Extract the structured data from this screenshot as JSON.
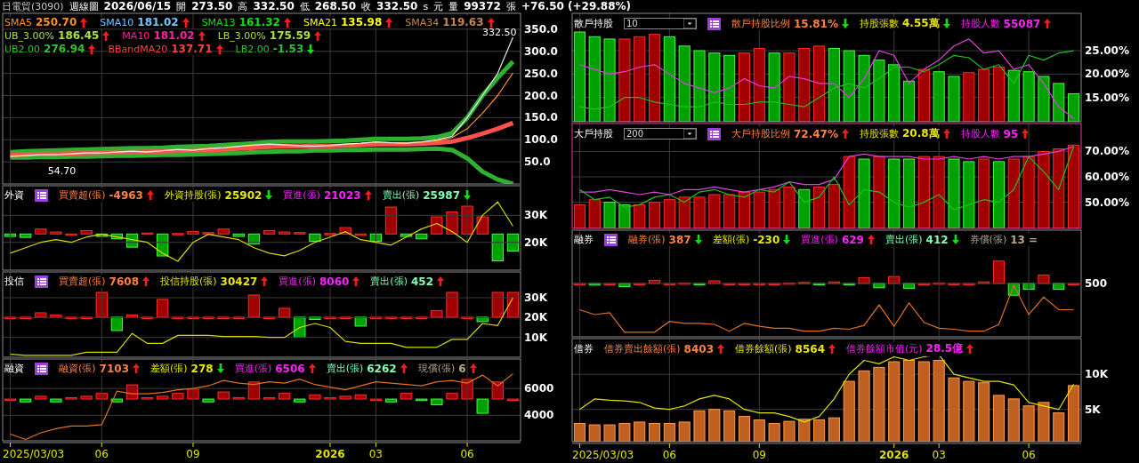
{
  "header": {
    "stock": "日電貿(3090)",
    "period": "週線圖",
    "date": "2026/06/15",
    "quotes": [
      {
        "label": "開",
        "value": "273.50"
      },
      {
        "label": "高",
        "value": "332.50"
      },
      {
        "label": "低",
        "value": "268.50"
      },
      {
        "label": "收",
        "value": "332.50",
        "suffixes": [
          "s",
          "元"
        ]
      },
      {
        "label": "量",
        "value": "99372",
        "suffixes": [
          "張"
        ]
      }
    ],
    "change": "+76.50 (+29.88%)"
  },
  "left": {
    "panels": [
      {
        "kind": "price",
        "legend_rows": [
          [
            {
              "label": "SMA5",
              "value": "250.70",
              "rising": true,
              "color": "#ff9020"
            },
            {
              "label": "SMA10",
              "value": "181.02",
              "rising": true,
              "color": "#70c8ff"
            },
            {
              "label": "SMA13",
              "value": "161.32",
              "rising": true,
              "color": "#10e010"
            },
            {
              "label": "SMA21",
              "value": "135.98",
              "rising": true,
              "color": "#ffff00"
            },
            {
              "label": "SMA34",
              "value": "119.63",
              "rising": true,
              "color": "#c08850"
            }
          ],
          [
            {
              "label": "UB_3.00%",
              "value": "186.45",
              "rising": true,
              "color": "#a8e040"
            },
            {
              "label": "MA10",
              "value": "181.02",
              "rising": true,
              "color": "#ff20a0"
            },
            {
              "label": "LB_3.00%",
              "value": "175.59",
              "rising": true,
              "color": "#a8e040"
            }
          ],
          [
            {
              "label": "UB2.00",
              "value": "276.94",
              "rising": true,
              "color": "#30c030"
            },
            {
              "label": "BBandMA20",
              "value": "137.71",
              "rising": true,
              "color": "#ff4040"
            },
            {
              "label": "LB2.00",
              "value": "-1.53",
              "rising": false,
              "color": "#30c030"
            }
          ]
        ],
        "chart_data": {
          "type": "line",
          "grid": true,
          "ylim": [
            0,
            386
          ],
          "yticks": [
            {
              "value": 50,
              "label": "50.0"
            },
            {
              "value": 100,
              "label": "100.0"
            },
            {
              "value": 150,
              "label": "150.0"
            },
            {
              "value": 200,
              "label": "200.0"
            },
            {
              "value": 250,
              "label": "250.0"
            },
            {
              "value": 300,
              "label": "300.0"
            },
            {
              "value": 350,
              "label": "350.0"
            }
          ],
          "annotations": [
            "332.50",
            "54.70"
          ],
          "series": [
            {
              "color": "#30b030",
              "values": [
                72,
                74,
                75,
                76,
                77,
                78,
                79,
                80,
                81,
                81,
                82,
                84,
                85,
                86,
                88,
                90,
                92,
                95,
                96,
                96,
                96,
                97,
                98,
                100,
                102,
                102,
                102,
                103,
                106,
                115,
                150,
                200,
                240,
                277
              ]
            },
            {
              "color": "#30b030",
              "values": [
                60,
                60,
                61,
                61,
                62,
                62,
                63,
                64,
                64,
                65,
                66,
                66,
                67,
                68,
                69,
                70,
                72,
                73,
                74,
                74,
                76,
                76,
                77,
                77,
                78,
                78,
                78,
                79,
                80,
                77,
                58,
                28,
                10,
                0
              ]
            },
            {
              "color": "#ff5050",
              "values": [
                66,
                67,
                68,
                68,
                69,
                70,
                71,
                72,
                72,
                73,
                74,
                75,
                76,
                77,
                78,
                80,
                82,
                84,
                85,
                85,
                86,
                86,
                87,
                88,
                90,
                90,
                90,
                91,
                93,
                96,
                104,
                114,
                125,
                138
              ]
            },
            {
              "color": "#ff9020",
              "values": [
                63,
                65,
                66,
                67,
                68,
                70,
                71,
                72,
                73,
                73,
                75,
                77,
                77,
                79,
                81,
                84,
                87,
                89,
                89,
                87,
                86,
                86,
                89,
                91,
                94,
                93,
                93,
                94,
                98,
                105,
                125,
                160,
                200,
                251
              ]
            },
            {
              "color": "#e8e8e8",
              "values": [
                62,
                64,
                66,
                66,
                68,
                70,
                70,
                72,
                74,
                72,
                75,
                78,
                76,
                80,
                82,
                85,
                88,
                90,
                88,
                86,
                85,
                87,
                90,
                92,
                95,
                93,
                92,
                95,
                100,
                108,
                150,
                200,
                250,
                332
              ]
            }
          ]
        }
      },
      {
        "kind": "flow",
        "title": "外資",
        "active": false,
        "has_menu": true,
        "stats": [
          {
            "label": "買賣超(張)",
            "value": "-4963",
            "rising": true,
            "color": "#ff8040"
          },
          {
            "label": "外資持股(張)",
            "value": "25902",
            "rising": false,
            "color": "#e8e800"
          },
          {
            "label": "買進(張)",
            "value": "21023",
            "rising": true,
            "color": "#ff20ff"
          },
          {
            "label": "賣出(張)",
            "value": "25987",
            "rising": false,
            "color": "#80ffb0"
          }
        ],
        "chart_data": {
          "type": "line",
          "grid": true,
          "ylim": [
            9700,
            41000
          ],
          "yticks": [
            {
              "value": 20000,
              "label": "20K"
            },
            {
              "value": 30000,
              "label": "30K"
            }
          ],
          "series": [
            {
              "color": "#d8d800",
              "values": [
                16000,
                18000,
                20000,
                21000,
                20000,
                22000,
                23000,
                22000,
                21000,
                20000,
                16000,
                13000,
                20000,
                23000,
                22000,
                21000,
                18000,
                16000,
                15000,
                17000,
                20000,
                22000,
                24000,
                21000,
                20000,
                19000,
                22000,
                25000,
                27000,
                24000,
                20000,
                30000,
                35000,
                26000
              ]
            }
          ]
        }
      },
      {
        "kind": "flow",
        "title": "投信",
        "active": false,
        "has_menu": true,
        "stats": [
          {
            "label": "買賣超(張)",
            "value": "7608",
            "rising": true,
            "color": "#ff8040"
          },
          {
            "label": "投信持股(張)",
            "value": "30427",
            "rising": true,
            "color": "#e8e800"
          },
          {
            "label": "買進(張)",
            "value": "8060",
            "rising": true,
            "color": "#ff20ff"
          },
          {
            "label": "賣出(張)",
            "value": "452",
            "rising": true,
            "color": "#80ffb0"
          }
        ],
        "chart_data": {
          "type": "line",
          "grid": true,
          "ylim": [
            0,
            43000
          ],
          "yticks": [
            {
              "value": 10000,
              "label": "10K"
            },
            {
              "value": 20000,
              "label": "20K"
            },
            {
              "value": 30000,
              "label": "30K"
            }
          ],
          "series": [
            {
              "color": "#d8d800",
              "values": [
                1500,
                1000,
                1000,
                1000,
                1000,
                2500,
                2500,
                2500,
                12000,
                7000,
                7000,
                11000,
                11000,
                11000,
                10500,
                10500,
                10500,
                10000,
                10000,
                15000,
                17000,
                15000,
                8000,
                7000,
                7000,
                7000,
                5000,
                5000,
                5000,
                9000,
                9000,
                17000,
                16000,
                30000
              ]
            }
          ]
        }
      },
      {
        "kind": "flow",
        "title": "融資",
        "active": false,
        "has_menu": true,
        "stats": [
          {
            "label": "融資(張)",
            "value": "7103",
            "rising": true,
            "color": "#ff8040"
          },
          {
            "label": "差額(張)",
            "value": "278",
            "rising": false,
            "color": "#e8e800"
          },
          {
            "label": "買進(張)",
            "value": "6506",
            "rising": true,
            "color": "#ff20ff"
          },
          {
            "label": "賣出(張)",
            "value": "6262",
            "rising": true,
            "color": "#80ffb0"
          },
          {
            "label": "現償(張)",
            "value": "6",
            "rising": true,
            "color": "#b8a890"
          }
        ],
        "chart_data": {
          "type": "line",
          "grid": true,
          "ylim": [
            2100,
            8200
          ],
          "yticks": [
            {
              "value": 4000,
              "label": "4000"
            },
            {
              "value": 6000,
              "label": "6000"
            }
          ],
          "series": [
            {
              "color": "#e07020",
              "values": [
                2600,
                2200,
                2700,
                3000,
                3200,
                3200,
                3300,
                5800,
                5600,
                5600,
                5700,
                5900,
                6000,
                6200,
                6600,
                6400,
                6300,
                6500,
                6400,
                6700,
                6300,
                6100,
                5900,
                6200,
                6500,
                6400,
                6300,
                6200,
                6500,
                6600,
                6400,
                7000,
                6200,
                7100
              ]
            }
          ]
        }
      }
    ],
    "x_axis": {
      "ticks": [
        {
          "label": "2025/03/03",
          "kind": "date"
        },
        {
          "label": "06",
          "kind": "month"
        },
        {
          "label": "09",
          "kind": "month"
        },
        {
          "label": "2026",
          "kind": "year"
        },
        {
          "label": "03",
          "kind": "month"
        },
        {
          "label": "06",
          "kind": "month"
        }
      ]
    }
  },
  "right": {
    "panels": [
      {
        "kind": "flow",
        "title": "散戶持股",
        "active": false,
        "has_menu": true,
        "dropdown": {
          "value": "10"
        },
        "stats": [
          {
            "label": "散戶持股比例",
            "value": "15.81%",
            "rising": false,
            "color": "#ff8040"
          },
          {
            "label": "持股張數",
            "value": "4.55萬",
            "rising": false,
            "color": "#e8e800"
          },
          {
            "label": "持股人數",
            "value": "55087",
            "rising": true,
            "color": "#ff20ff"
          }
        ],
        "chart_data": {
          "type": "bar",
          "grid": true,
          "ylim": [
            9.8,
            33
          ],
          "yticks": [
            {
              "value": 15,
              "label": "15.00%"
            },
            {
              "value": 20,
              "label": "20.00%"
            },
            {
              "value": 25,
              "label": "25.00%"
            }
          ],
          "series": [
            {
              "type": "bar",
              "values": [
                29,
                28,
                27.5,
                27.5,
                28,
                28.5,
                28,
                26,
                25,
                24.5,
                24,
                24.5,
                25.5,
                24.5,
                24.5,
                25.5,
                26,
                25.5,
                25,
                24,
                23,
                22,
                18.5,
                21,
                20.5,
                19.5,
                20.3,
                21,
                21.5,
                20.8,
                20.5,
                19.5,
                18,
                15.8
              ],
              "colors": [
                "#00a000",
                "#00a000",
                "#00a000",
                "#a00000",
                "#a00000",
                "#a00000",
                "#00a000",
                "#00a000",
                "#00a000",
                "#00a000",
                "#00a000",
                "#a00000",
                "#a00000",
                "#00a000",
                "#a00000",
                "#a00000",
                "#a00000",
                "#00a000",
                "#00a000",
                "#00a000",
                "#00a000",
                "#00a000",
                "#00a000",
                "#a00000",
                "#00a000",
                "#00a000",
                "#a00000",
                "#a00000",
                "#a00000",
                "#00a000",
                "#00a000",
                "#00a000",
                "#00a000",
                "#00a000"
              ]
            },
            {
              "type": "line",
              "color": "#e040e0",
              "values": [
                22,
                21,
                20,
                20.5,
                21.5,
                22,
                20,
                18,
                17,
                16,
                17,
                19,
                17.5,
                17,
                19.5,
                19,
                18,
                18,
                15,
                19,
                25,
                24,
                18,
                21,
                23,
                26,
                27.5,
                24.5,
                25,
                21,
                22,
                18,
                13,
                10.5
              ]
            },
            {
              "type": "line",
              "color": "#20c020",
              "values": [
                13,
                12.5,
                13,
                15,
                15,
                14,
                13.5,
                13,
                13,
                14,
                13.5,
                13.5,
                14,
                14,
                13.5,
                13,
                15,
                17,
                18,
                17,
                19,
                21.5,
                21.5,
                20.5,
                22,
                24,
                23.5,
                21,
                22,
                18,
                24,
                23,
                24.5,
                25
              ]
            }
          ]
        }
      },
      {
        "kind": "flow",
        "title": "大戶持股",
        "active": true,
        "has_menu": true,
        "dropdown": {
          "value": "200"
        },
        "stats": [
          {
            "label": "大戶持股比例",
            "value": "72.47%",
            "rising": true,
            "color": "#ff8040"
          },
          {
            "label": "持股張數",
            "value": "20.8萬",
            "rising": true,
            "color": "#e8e800"
          },
          {
            "label": "持股人數",
            "value": "95",
            "rising": true,
            "color": "#ff20ff"
          }
        ],
        "chart_data": {
          "type": "bar",
          "grid": true,
          "ylim": [
            39.7,
            81
          ],
          "yticks": [
            {
              "value": 50,
              "label": "50.00%"
            },
            {
              "value": 60,
              "label": "60.00%"
            },
            {
              "value": 70,
              "label": "70.00%"
            }
          ],
          "series": [
            {
              "type": "bar",
              "values": [
                49,
                51,
                50,
                49,
                49,
                50,
                51,
                52,
                52,
                53,
                53,
                54,
                54,
                55,
                56,
                55,
                56,
                57,
                68,
                67,
                68,
                67,
                67,
                68,
                68,
                67,
                66,
                67,
                66,
                67,
                68,
                70,
                71,
                72.5
              ],
              "colors": [
                "#a00000",
                "#a00000",
                "#00a000",
                "#00a000",
                "#a00000",
                "#a00000",
                "#a00000",
                "#a00000",
                "#a00000",
                "#a00000",
                "#a00000",
                "#a00000",
                "#a00000",
                "#a00000",
                "#a00000",
                "#00a000",
                "#a00000",
                "#a00000",
                "#a00000",
                "#00a000",
                "#a00000",
                "#00a000",
                "#00a000",
                "#a00000",
                "#a00000",
                "#00a000",
                "#00a000",
                "#a00000",
                "#00a000",
                "#a00000",
                "#a00000",
                "#a00000",
                "#a00000",
                "#a00000"
              ]
            },
            {
              "type": "line",
              "color": "#e040e0",
              "values": [
                54,
                54,
                55,
                54,
                53,
                54,
                53,
                55,
                55,
                56,
                55,
                54,
                55,
                56,
                58,
                57,
                57,
                59,
                68,
                69,
                68,
                68,
                68,
                67,
                67,
                68,
                67,
                68,
                67,
                68,
                68,
                69,
                70,
                72
              ]
            },
            {
              "type": "line",
              "color": "#20c020",
              "values": [
                55,
                51,
                52,
                48,
                49,
                52,
                53,
                50,
                54,
                55,
                53,
                52,
                55,
                54,
                58,
                50,
                52,
                60,
                49,
                55,
                54,
                50,
                48,
                50,
                53,
                47,
                49,
                51,
                50,
                55,
                68,
                62,
                55,
                72
              ]
            }
          ]
        }
      },
      {
        "kind": "flow",
        "title": "融券",
        "active": false,
        "has_menu": true,
        "stats": [
          {
            "label": "融券(張)",
            "value": "387",
            "rising": false,
            "color": "#ff8040"
          },
          {
            "label": "差額(張)",
            "value": "-230",
            "rising": false,
            "color": "#e8e800"
          },
          {
            "label": "買進(張)",
            "value": "629",
            "rising": true,
            "color": "#ff20ff"
          },
          {
            "label": "賣出(張)",
            "value": "412",
            "rising": false,
            "color": "#80ffb0"
          },
          {
            "label": "券償(張)",
            "value": "13 =",
            "arrow": false,
            "color": "#b8a890"
          }
        ],
        "chart_picture": {
          "tick_label": "500"
        }
      },
      {
        "kind": "flow",
        "title": "借券",
        "active": false,
        "has_menu": false,
        "stats": [
          {
            "label": "借券賣出餘額(張)",
            "value": "8403",
            "rising": true,
            "color": "#ff8040"
          },
          {
            "label": "借券餘額(張)",
            "value": "8564",
            "rising": true,
            "color": "#e8e800"
          },
          {
            "label": "借券餘額市值(元)",
            "value": "28.5億",
            "rising": true,
            "color": "#ff20ff"
          }
        ],
        "chart_data": {
          "type": "bar",
          "grid": true,
          "ylim": [
            400,
            15100
          ],
          "yticks": [
            {
              "value": 5000,
              "label": "5K"
            },
            {
              "value": 10000,
              "label": "10K"
            }
          ],
          "series": [
            {
              "type": "bar",
              "color": "#c06020",
              "values": [
                3000,
                2800,
                2800,
                3000,
                3200,
                3000,
                3000,
                3200,
                4800,
                5000,
                4800,
                4000,
                3500,
                3000,
                3300,
                3600,
                3500,
                3800,
                9000,
                10500,
                11000,
                11800,
                12000,
                11800,
                12000,
                9500,
                9000,
                8800,
                7000,
                6500,
                5500,
                6000,
                4500,
                8400
              ]
            },
            {
              "type": "line",
              "color": "#e0e000",
              "values": [
                5000,
                6500,
                6300,
                6200,
                6000,
                5200,
                5000,
                5500,
                6500,
                7000,
                6500,
                5000,
                4500,
                4500,
                4000,
                3200,
                4000,
                6500,
                10000,
                12000,
                11500,
                12500,
                12000,
                12500,
                12800,
                10000,
                9500,
                9000,
                9000,
                8500,
                6000,
                5500,
                5000,
                8600
              ]
            }
          ]
        }
      }
    ],
    "x_axis": {
      "ticks": [
        {
          "label": "2025/03/03",
          "kind": "date"
        },
        {
          "label": "06",
          "kind": "month"
        },
        {
          "label": "09",
          "kind": "month"
        },
        {
          "label": "2026",
          "kind": "year"
        },
        {
          "label": "03",
          "kind": "month"
        },
        {
          "label": "06",
          "kind": "month"
        }
      ]
    }
  }
}
